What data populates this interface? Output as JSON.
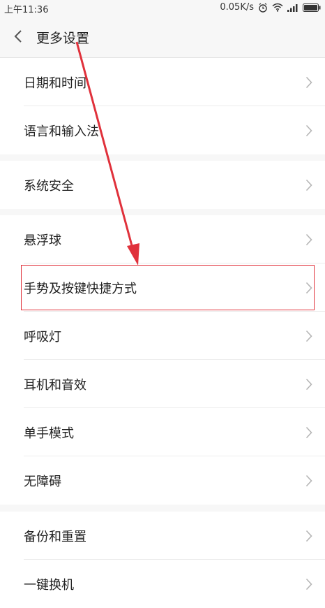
{
  "status_bar": {
    "time": "上午11:36",
    "network_speed": "0.05K/s",
    "icons": [
      "alarm-icon",
      "wifi-icon",
      "signal-icon",
      "battery-icon"
    ]
  },
  "header": {
    "title": "更多设置",
    "back_icon": "chevron-left-icon"
  },
  "groups": [
    {
      "items": [
        {
          "label": "日期和时间"
        },
        {
          "label": "语言和输入法"
        }
      ]
    },
    {
      "items": [
        {
          "label": "系统安全"
        }
      ]
    },
    {
      "items": [
        {
          "label": "悬浮球"
        },
        {
          "label": "手势及按键快捷方式"
        },
        {
          "label": "呼吸灯"
        },
        {
          "label": "耳机和音效"
        },
        {
          "label": "单手模式"
        },
        {
          "label": "无障碍"
        }
      ]
    },
    {
      "items": [
        {
          "label": "备份和重置"
        },
        {
          "label": "一键换机"
        }
      ]
    }
  ],
  "annotation": {
    "highlighted_item": "手势及按键快捷方式",
    "color": "#e0313b"
  },
  "colors": {
    "background": "#f7f7f7",
    "list_background": "#ffffff",
    "chevron": "#b5b5b5"
  }
}
